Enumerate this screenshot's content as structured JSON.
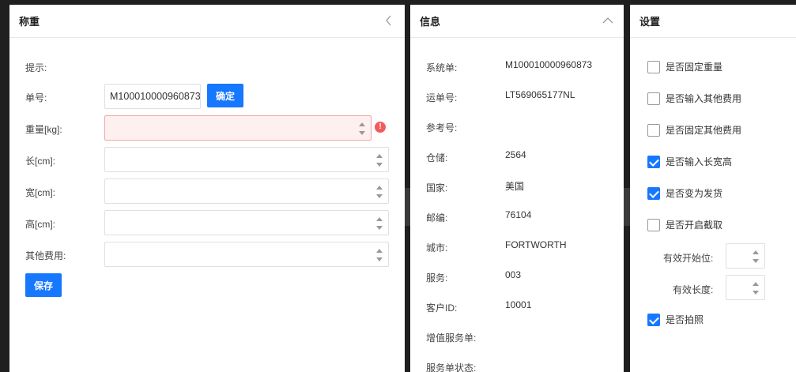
{
  "weight_panel": {
    "title": "称重",
    "hint_label": "提示:",
    "order_label": "单号:",
    "order_value": "M100010000960873",
    "confirm_label": "确定",
    "weight_label": "重量[kg]:",
    "length_label": "长[cm]:",
    "width_label": "宽[cm]:",
    "height_label": "高[cm]:",
    "other_fee_label": "其他费用:",
    "save_label": "保存",
    "error_mark": "!"
  },
  "info_panel": {
    "title": "信息",
    "rows": [
      {
        "label": "系统单:",
        "value": "M100010000960873"
      },
      {
        "label": "运单号:",
        "value": "LT569065177NL"
      },
      {
        "label": "参考号:",
        "value": ""
      },
      {
        "label": "仓储:",
        "value": "2564"
      },
      {
        "label": "国家:",
        "value": "美国"
      },
      {
        "label": "邮编:",
        "value": "76104"
      },
      {
        "label": "城市:",
        "value": "FORTWORTH"
      },
      {
        "label": "服务:",
        "value": "003"
      },
      {
        "label": "客户ID:",
        "value": "10001"
      },
      {
        "label": "增值服务单:",
        "value": ""
      },
      {
        "label": "服务单状态:",
        "value": ""
      }
    ]
  },
  "settings_panel": {
    "title": "设置",
    "checkboxes": [
      {
        "label": "是否固定重量",
        "checked": false
      },
      {
        "label": "是否输入其他费用",
        "checked": false
      },
      {
        "label": "是否固定其他费用",
        "checked": false
      },
      {
        "label": "是否输入长宽高",
        "checked": true
      },
      {
        "label": "是否变为发货",
        "checked": true
      },
      {
        "label": "是否开启截取",
        "checked": false
      }
    ],
    "start_pos_label": "有效开始位:",
    "length_label": "有效长度:",
    "photo_label": "是否拍照",
    "photo_checked": true
  },
  "colors": {
    "primary": "#1677ff",
    "error": "#f25c5c"
  }
}
